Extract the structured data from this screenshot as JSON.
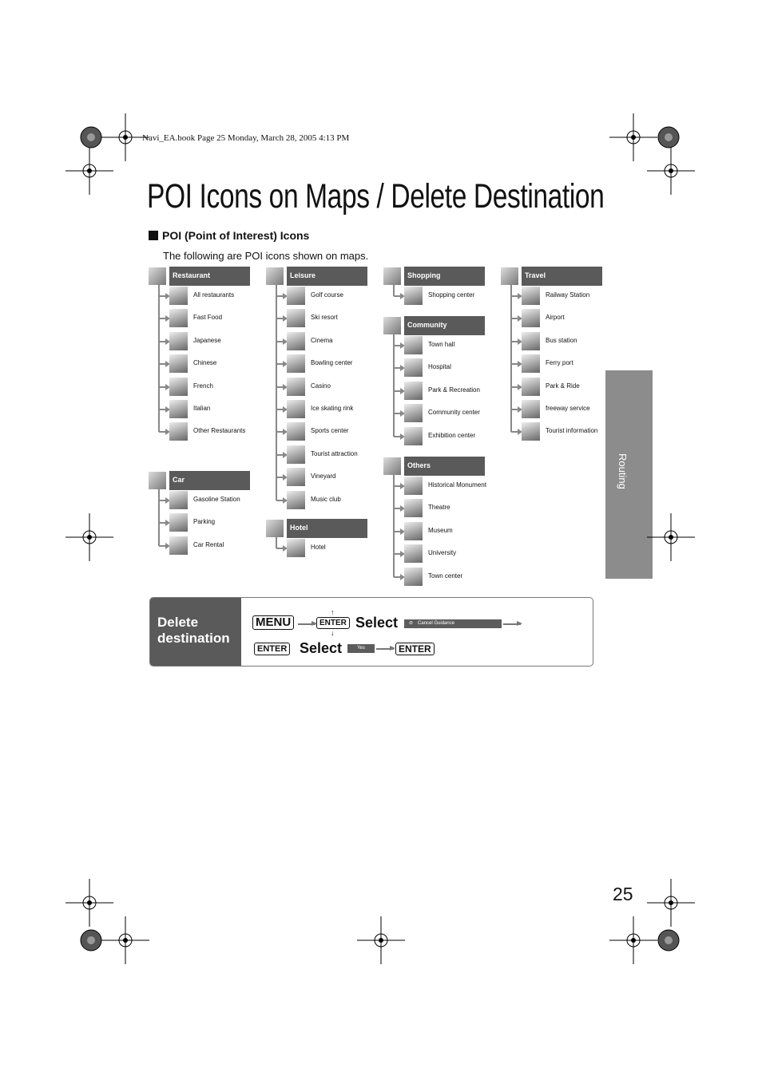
{
  "header_line": "Navi_EA.book  Page 25  Monday, March 28, 2005  4:13 PM",
  "title": "POI Icons on Maps / Delete Destination",
  "section": "POI (Point of Interest) Icons",
  "intro": "The following are POI icons shown on maps.",
  "groups": [
    {
      "name": "Restaurant",
      "items": [
        "All restaurants",
        "Fast Food",
        "Japanese",
        "Chinese",
        "French",
        "Italian",
        "Other Restaurants"
      ]
    },
    {
      "name": "Car",
      "items": [
        "Gasoline Station",
        "Parking",
        "Car Rental"
      ]
    },
    {
      "name": "Leisure",
      "items": [
        "Golf course",
        "Ski resort",
        "Cinema",
        "Bowling center",
        "Casino",
        "Ice skating rink",
        "Sports center",
        "Tourist attraction",
        "Vineyard",
        "Music club"
      ]
    },
    {
      "name": "Hotel",
      "items": [
        "Hotel"
      ]
    },
    {
      "name": "Shopping",
      "items": [
        "Shopping center"
      ]
    },
    {
      "name": "Community",
      "items": [
        "Town hall",
        "Hospital",
        "Park & Recreation",
        "Community center",
        "Exhibition center"
      ]
    },
    {
      "name": "Others",
      "items": [
        "Historical Monument",
        "Theatre",
        "Museum",
        "University",
        "Town center"
      ]
    },
    {
      "name": "Travel",
      "items": [
        "Railway Station",
        "Airport",
        "Bus station",
        "Ferry port",
        "Park & Ride",
        "freeway service",
        "Tourist information"
      ]
    }
  ],
  "side_tab": "Routing",
  "delete": {
    "label": "Delete destination",
    "menu_key": "MENU",
    "enter_key": "ENTER",
    "select": "Select",
    "cancel_item": "Cancel Guidance",
    "yes_item": "Yes"
  },
  "page_number": "25"
}
